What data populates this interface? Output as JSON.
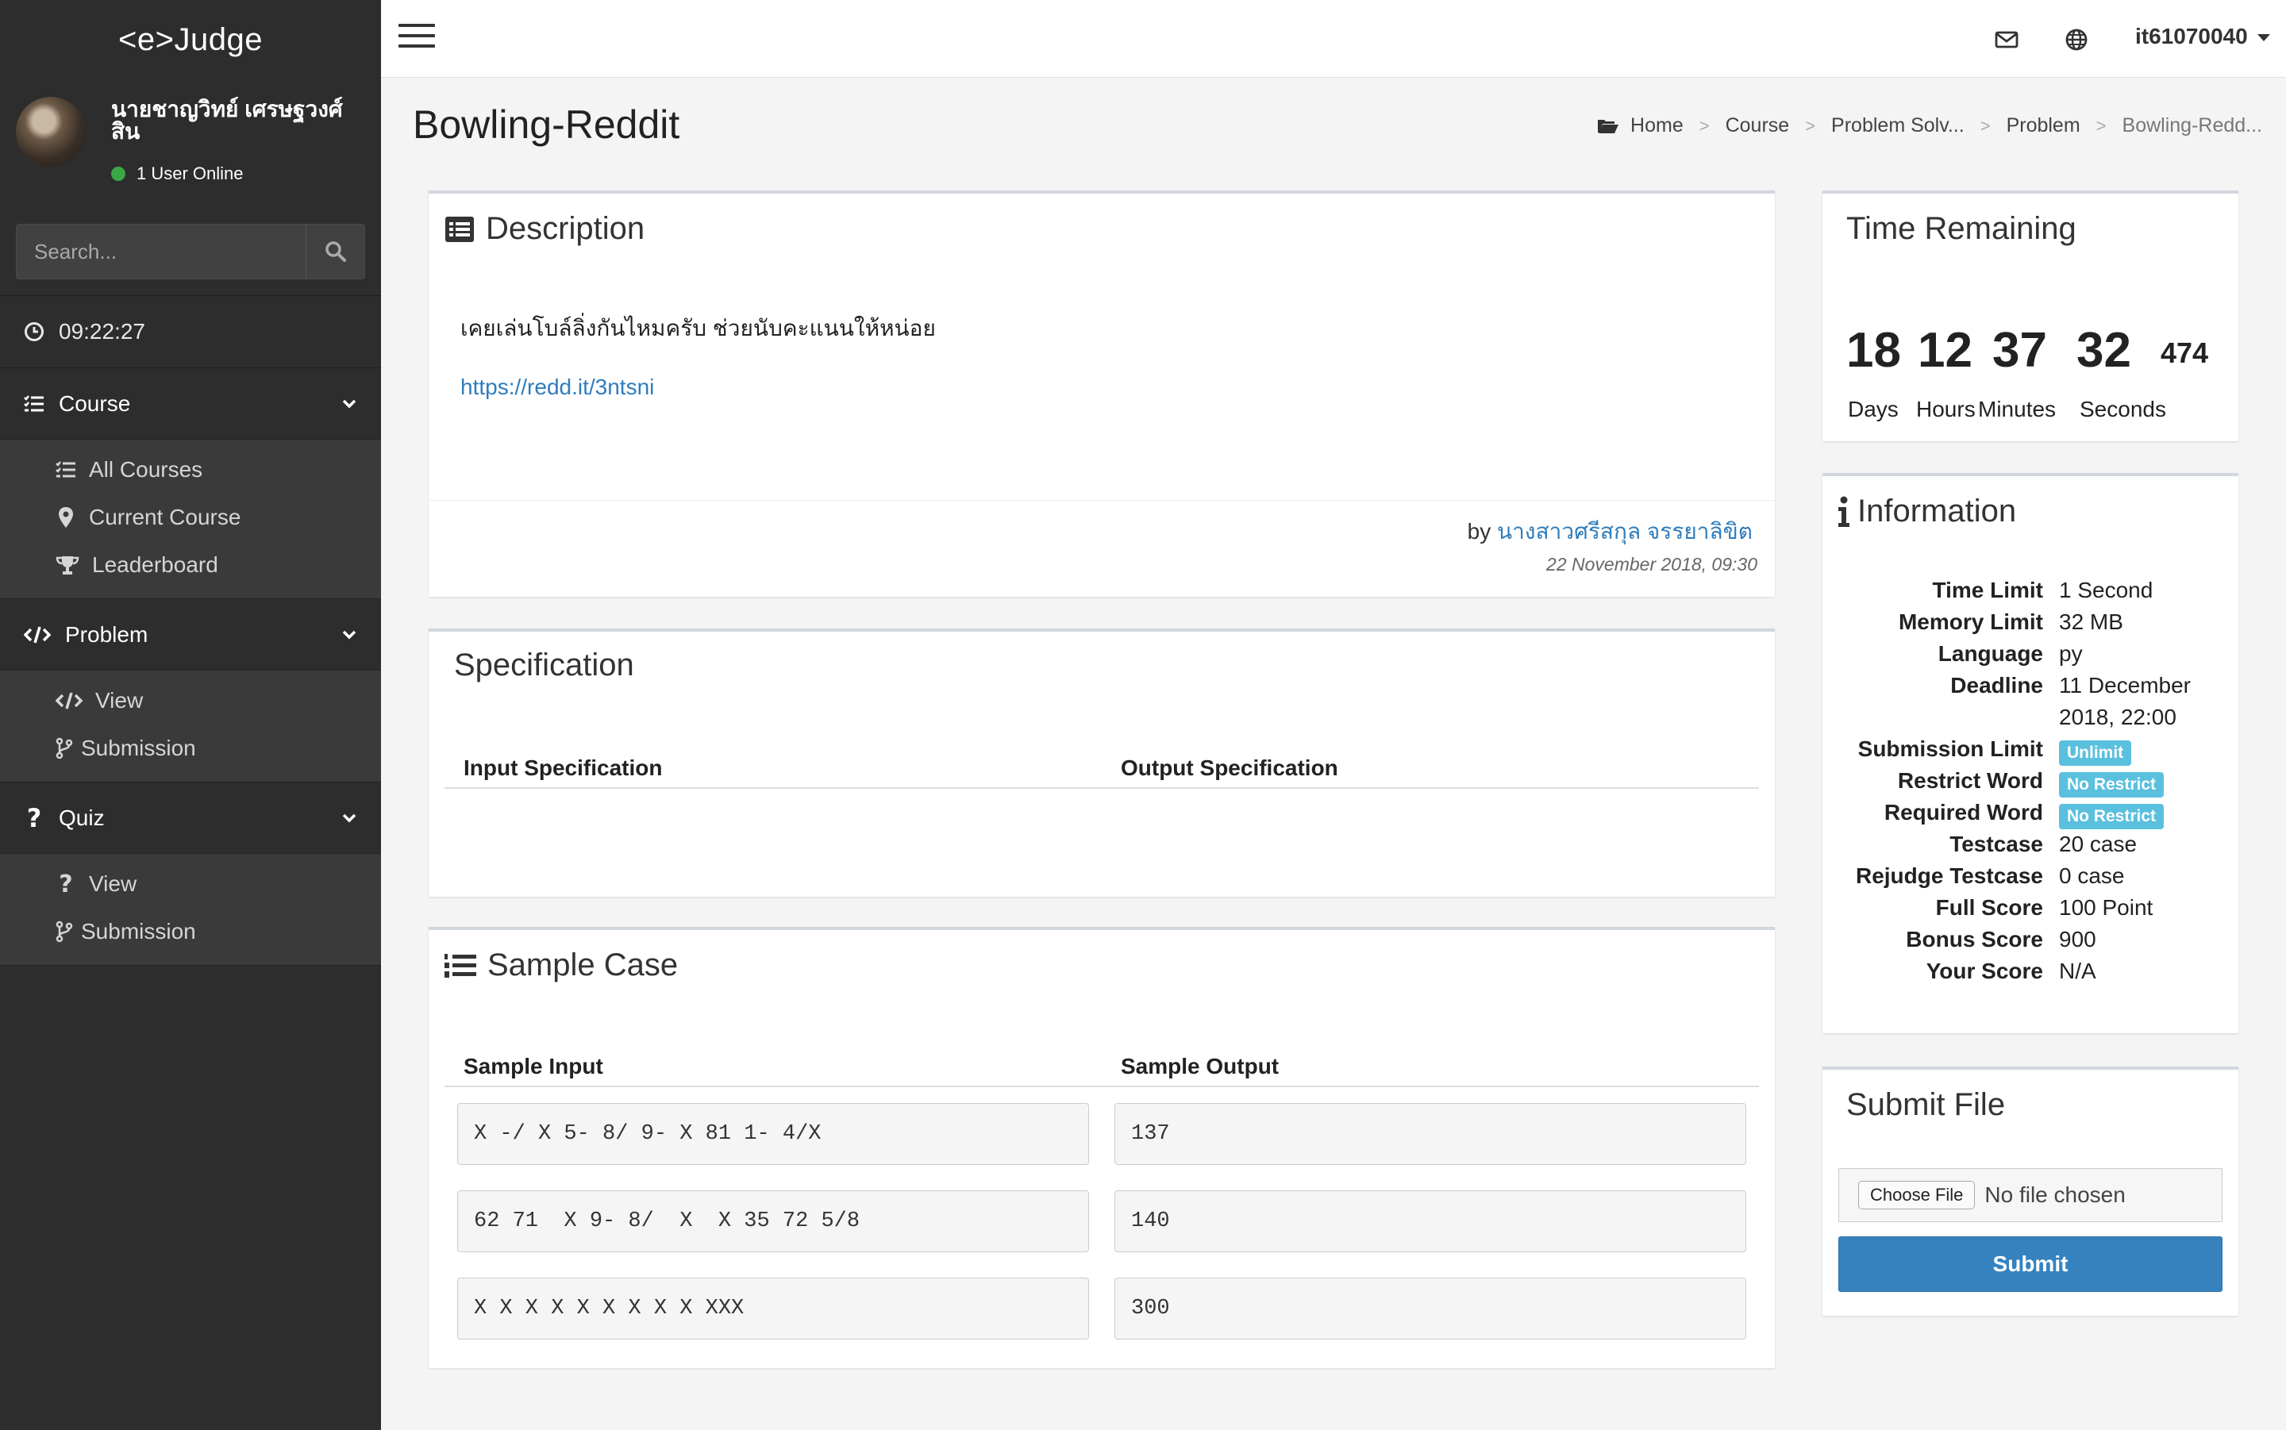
{
  "app": {
    "brand": "<e>Judge"
  },
  "user": {
    "name": "นายชาญวิทย์ เศรษฐวงศ์สิน",
    "online": "1 User Online",
    "username": "it61070040"
  },
  "sidebar": {
    "search_placeholder": "Search...",
    "clock": "09:22:27",
    "sections": [
      {
        "label": "Course",
        "items": [
          "All Courses",
          "Current Course",
          "Leaderboard"
        ]
      },
      {
        "label": "Problem",
        "items": [
          "View",
          "Submission"
        ]
      },
      {
        "label": "Quiz",
        "items": [
          "View",
          "Submission"
        ]
      }
    ]
  },
  "page": {
    "title": "Bowling-Reddit",
    "breadcrumb": [
      "Home",
      "Course",
      "Problem Solv...",
      "Problem",
      "Bowling-Redd..."
    ]
  },
  "description": {
    "title": "Description",
    "text": "เคยเล่นโบล์ลิ่งกันไหมครับ ช่วยนับคะแนนให้หน่อย",
    "link": "https://redd.it/3ntsni",
    "by_label": "by",
    "author": "นางสาวศรีสกุล จรรยาลิขิต",
    "date": "22 November 2018, 09:30"
  },
  "specification": {
    "title": "Specification",
    "input_header": "Input Specification",
    "output_header": "Output Specification"
  },
  "sample": {
    "title": "Sample Case",
    "input_header": "Sample Input",
    "output_header": "Sample Output",
    "rows": [
      {
        "input": "X -/ X 5- 8/ 9- X 81 1- 4/X",
        "output": "137"
      },
      {
        "input": "62 71  X 9- 8/  X  X 35 72 5/8",
        "output": "140"
      },
      {
        "input": "X X X X X X X X X XXX",
        "output": "300"
      }
    ]
  },
  "time_remaining": {
    "title": "Time Remaining",
    "days": "18",
    "hours": "12",
    "minutes": "37",
    "seconds": "32",
    "millis": "474",
    "labels": {
      "days": "Days",
      "hours": "Hours",
      "minutes": "Minutes",
      "seconds": "Seconds"
    }
  },
  "information": {
    "title": "Information",
    "rows": [
      {
        "key": "Time Limit",
        "value": "1 Second"
      },
      {
        "key": "Memory Limit",
        "value": "32 MB"
      },
      {
        "key": "Language",
        "value": "py"
      },
      {
        "key": "Deadline",
        "value": "11 December",
        "value2": "2018, 22:00"
      },
      {
        "key": "Submission Limit",
        "badge": "Unlimit"
      },
      {
        "key": "Restrict Word",
        "badge": "No Restrict"
      },
      {
        "key": "Required Word",
        "badge": "No Restrict"
      },
      {
        "key": "Testcase",
        "value": "20 case"
      },
      {
        "key": "Rejudge Testcase",
        "value": "0 case"
      },
      {
        "key": "Full Score",
        "value": "100 Point"
      },
      {
        "key": "Bonus Score",
        "value": "900"
      },
      {
        "key": "Your Score",
        "value": "N/A"
      }
    ]
  },
  "submit": {
    "title": "Submit File",
    "choose_label": "Choose File",
    "no_file": "No file chosen",
    "submit_label": "Submit"
  },
  "icons": {
    "search": "search-icon",
    "clock": "clock-icon",
    "course": "list-check-icon",
    "problem": "code-icon",
    "quiz": "question-icon",
    "mail": "envelope-icon",
    "globe": "globe-icon"
  },
  "colors": {
    "sidebar": "#2d2d2d",
    "link": "#2f7dbd",
    "badge": "#5bc0de",
    "submit": "#3582bf",
    "online": "#3aa845"
  }
}
